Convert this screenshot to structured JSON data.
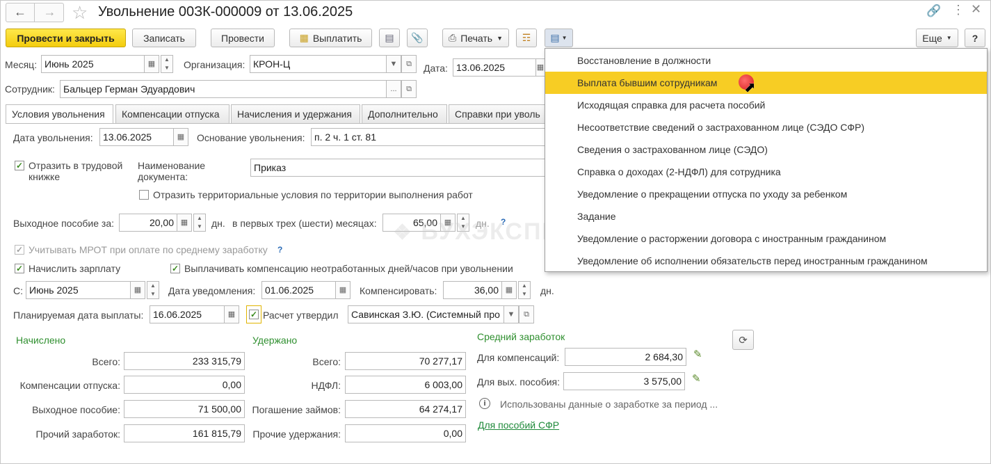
{
  "window": {
    "title": "Увольнение 00ЗК-000009 от 13.06.2025"
  },
  "toolbar": {
    "post_close": "Провести и закрыть",
    "save": "Записать",
    "post": "Провести",
    "pay": "Выплатить",
    "print": "Печать",
    "more": "Еще",
    "help": "?"
  },
  "header": {
    "month_label": "Месяц:",
    "month_value": "Июнь 2025",
    "org_label": "Организация:",
    "org_value": "КРОН-Ц",
    "date_label": "Дата:",
    "date_value": "13.06.2025",
    "employee_label": "Сотрудник:",
    "employee_value": "Бальцер Герман Эдуардович"
  },
  "tabs": [
    {
      "label": "Условия увольнения"
    },
    {
      "label": "Компенсации отпуска"
    },
    {
      "label": "Начисления и удержания"
    },
    {
      "label": "Дополнительно"
    },
    {
      "label": "Справки при уволь"
    }
  ],
  "conditions": {
    "dismissal_date_label": "Дата увольнения:",
    "dismissal_date_value": "13.06.2025",
    "reason_label": "Основание увольнения:",
    "reason_value": "п. 2 ч. 1 ст. 81",
    "workbook_label": "Отразить в трудовой книжке",
    "workbook_checked": true,
    "doc_name_label": "Наименование документа:",
    "doc_name_value": "Приказ",
    "territorial_label": "Отразить территориальные условия по территории выполнения работ",
    "territorial_checked": false,
    "severance_label": "Выходное пособие за:",
    "severance_days": "20,00",
    "days_unit": "дн.",
    "first_months_label": "в первых трех (шести) месяцах:",
    "first_months_days": "65,00",
    "mrot_label": "Учитывать МРОТ при оплате по среднему заработку",
    "mrot_checked": true,
    "salary_label": "Начислить зарплату",
    "salary_checked": true,
    "compensation_label": "Выплачивать компенсацию неотработанных дней/часов при увольнении",
    "compensation_checked": true,
    "from_label": "С:",
    "from_value": "Июнь 2025",
    "notice_label": "Дата уведомления:",
    "notice_value": "01.06.2025",
    "compensate_label": "Компенсировать:",
    "compensate_value": "36,00",
    "planned_label": "Планируемая дата выплаты:",
    "planned_value": "16.06.2025",
    "approved_label": "Расчет утвердил",
    "approved_checked": true,
    "approver_value": "Савинская З.Ю. (Системный про"
  },
  "accrued": {
    "title": "Начислено",
    "rows": [
      {
        "label": "Всего:",
        "value": "233 315,79"
      },
      {
        "label": "Компенсации отпуска:",
        "value": "0,00"
      },
      {
        "label": "Выходное пособие:",
        "value": "71 500,00"
      },
      {
        "label": "Прочий заработок:",
        "value": "161 815,79"
      }
    ]
  },
  "withheld": {
    "title": "Удержано",
    "rows": [
      {
        "label": "Всего:",
        "value": "70 277,17"
      },
      {
        "label": "НДФЛ:",
        "value": "6 003,00"
      },
      {
        "label": "Погашение займов:",
        "value": "64 274,17"
      },
      {
        "label": "Прочие удержания:",
        "value": "0,00"
      }
    ]
  },
  "average": {
    "title": "Средний заработок",
    "comp_label": "Для компенсаций:",
    "comp_value": "2 684,30",
    "sev_label": "Для вых. пособия:",
    "sev_value": "3 575,00",
    "info_text": "Использованы данные о заработке за период ...",
    "sfr_link": "Для пособий СФР"
  },
  "menu": {
    "items": [
      "Восстановление в должности",
      "Выплата бывшим сотрудникам",
      "Исходящая справка для расчета пособий",
      "Несоответствие сведений о застрахованном лице (СЭДО СФР)",
      "Сведения о застрахованном лице (СЭДО)",
      "Справка о доходах (2-НДФЛ) для сотрудника",
      "Уведомление о прекращении отпуска по уходу за ребенком",
      "Задание",
      "Уведомление о расторжении договора с иностранным гражданином",
      "Уведомлениe об исполнении обязательств перед иностранным гражданином"
    ],
    "highlighted_index": 1
  },
  "watermark": "БУХЭКСПЕРТ",
  "colors": {
    "accent": "#f7cd24",
    "section_title": "#2f8f2f",
    "checkmark": "#3a8a1e"
  }
}
